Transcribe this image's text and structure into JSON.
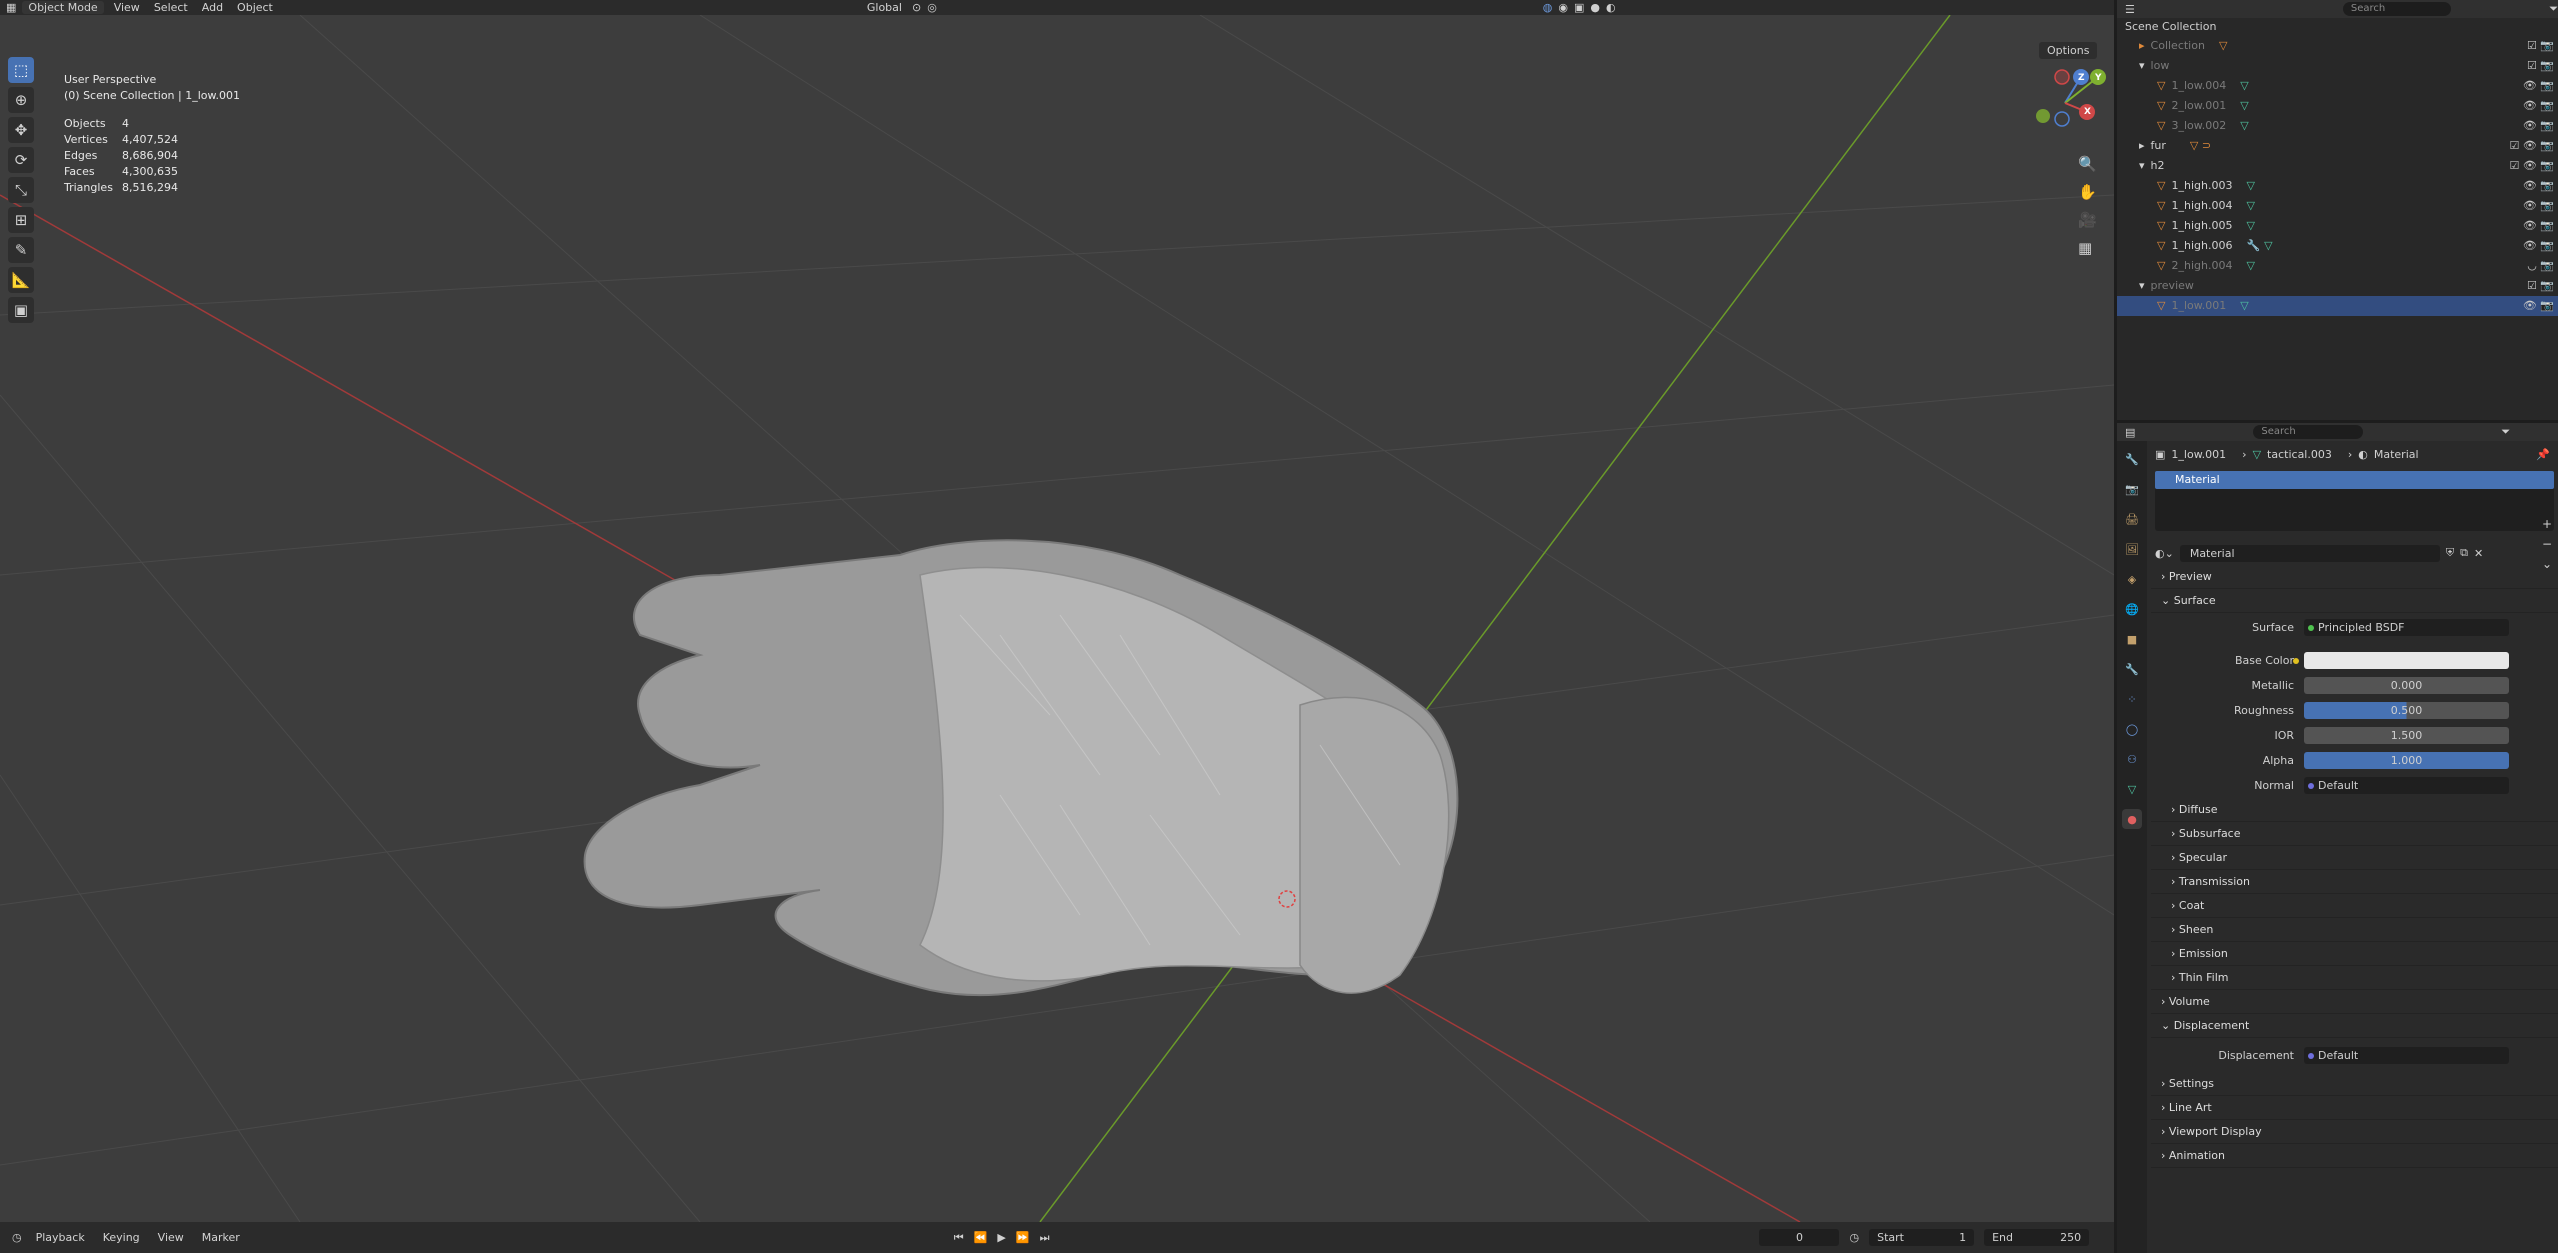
{
  "header": {
    "mode": "Object Mode",
    "menus": [
      "View",
      "Select",
      "Add",
      "Object"
    ],
    "transform_orientation": "Global",
    "search_placeholder": "Search"
  },
  "viewport": {
    "perspective": "User Perspective",
    "collection_path": "(0) Scene Collection | 1_low.001",
    "stats": [
      {
        "label": "Objects",
        "value": "4"
      },
      {
        "label": "Vertices",
        "value": "4,407,524"
      },
      {
        "label": "Edges",
        "value": "8,686,904"
      },
      {
        "label": "Faces",
        "value": "4,300,635"
      },
      {
        "label": "Triangles",
        "value": "8,516,294"
      }
    ],
    "options_label": "Options",
    "gizmo": {
      "x": "X",
      "y": "Y",
      "z": "Z"
    }
  },
  "timeline": {
    "menus": [
      "Playback",
      "Keying",
      "View",
      "Marker"
    ],
    "current_frame": "0",
    "start_label": "Start",
    "start_value": "1",
    "end_label": "End",
    "end_value": "250"
  },
  "outliner": {
    "search_placeholder": "Search",
    "root": "Scene Collection",
    "rows": [
      {
        "label": "Collection",
        "dim": true
      },
      {
        "label": "low",
        "dim": true
      },
      {
        "label": "1_low.004",
        "dim": true
      },
      {
        "label": "2_low.001",
        "dim": true
      },
      {
        "label": "3_low.002",
        "dim": true
      },
      {
        "label": "fur",
        "dim": false
      },
      {
        "label": "h2",
        "dim": false
      },
      {
        "label": "1_high.003",
        "dim": false
      },
      {
        "label": "1_high.004",
        "dim": false
      },
      {
        "label": "1_high.005",
        "dim": false
      },
      {
        "label": "1_high.006",
        "dim": false
      },
      {
        "label": "2_high.004",
        "dim": true
      },
      {
        "label": "preview",
        "dim": true
      },
      {
        "label": "1_low.001",
        "dim": true
      }
    ]
  },
  "properties": {
    "search_placeholder": "Search",
    "breadcrumb": [
      "1_low.001",
      "tactical.003",
      "Material"
    ],
    "slot": "Material",
    "material_name": "Material",
    "panels": {
      "preview": "Preview",
      "surface": "Surface",
      "diffuse": "Diffuse",
      "subsurface": "Subsurface",
      "specular": "Specular",
      "transmission": "Transmission",
      "coat": "Coat",
      "sheen": "Sheen",
      "emission": "Emission",
      "thin_film": "Thin Film",
      "volume": "Volume",
      "displacement": "Displacement",
      "settings": "Settings",
      "line_art": "Line Art",
      "viewport_display": "Viewport Display",
      "animation": "Animation"
    },
    "surface": {
      "surface_label": "Surface",
      "surface_value": "Principled BSDF",
      "base_color_label": "Base Color",
      "base_color": "#e8e8e8",
      "metallic_label": "Metallic",
      "metallic": "0.000",
      "roughness_label": "Roughness",
      "roughness": "0.500",
      "ior_label": "IOR",
      "ior": "1.500",
      "alpha_label": "Alpha",
      "alpha": "1.000",
      "normal_label": "Normal",
      "normal": "Default"
    },
    "displacement": {
      "label": "Displacement",
      "value": "Default"
    }
  }
}
